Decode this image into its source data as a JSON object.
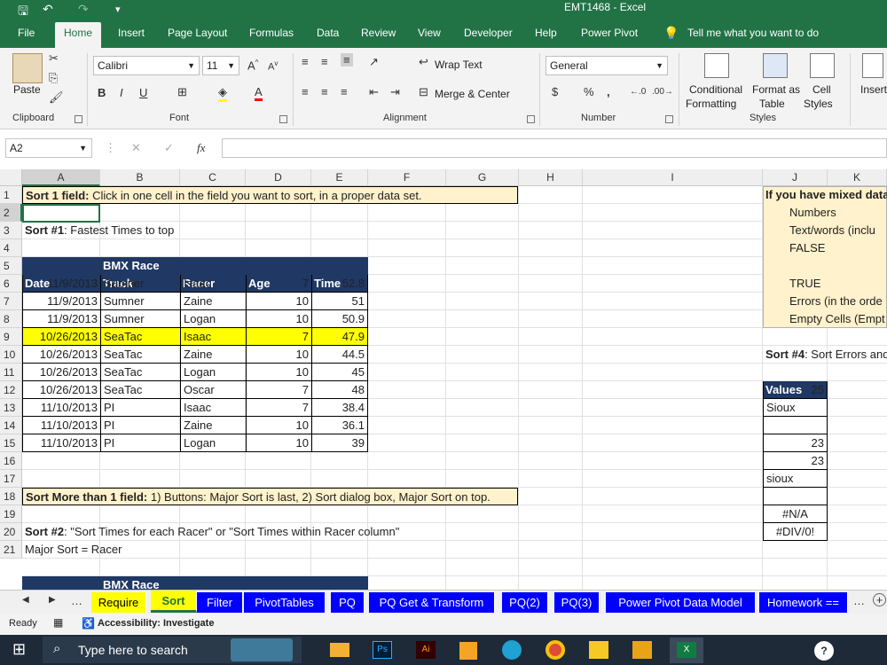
{
  "window": {
    "title": "EMT1468  -  Excel"
  },
  "menu": {
    "tabs": [
      "File",
      "Home",
      "Insert",
      "Page Layout",
      "Formulas",
      "Data",
      "Review",
      "View",
      "Developer",
      "Help",
      "Power Pivot"
    ],
    "tell_me": "Tell me what you want to do",
    "active": "Home"
  },
  "ribbon": {
    "paste": "Paste",
    "clipboard": "Clipboard",
    "font_name": "Calibri",
    "font_size": "11",
    "font": "Font",
    "wrap_text": "Wrap Text",
    "merge_center": "Merge & Center",
    "alignment": "Alignment",
    "number_format": "General",
    "number": "Number",
    "conditional_1": "Conditional",
    "conditional_2": "Formatting",
    "format_as_1": "Format as",
    "format_as_2": "Table",
    "cell_styles_1": "Cell",
    "cell_styles_2": "Styles",
    "styles": "Styles",
    "insert": "Insert",
    "bold": "B",
    "italic": "I",
    "underline": "U",
    "currency": "$",
    "percent": "%",
    "comma": ","
  },
  "formula_bar": {
    "name_box": "A2",
    "fx": "fx",
    "formula": ""
  },
  "columns": [
    "A",
    "B",
    "C",
    "D",
    "E",
    "F",
    "G",
    "H",
    "I",
    "J",
    "K"
  ],
  "rows": [
    "1",
    "2",
    "3",
    "4",
    "5",
    "6",
    "7",
    "8",
    "9",
    "10",
    "11",
    "12",
    "13",
    "14",
    "15",
    "16",
    "17",
    "18",
    "19",
    "20",
    "21"
  ],
  "cells": {
    "r1_bold": "Sort 1 field:",
    "r1_rest": " Click in one cell in the field you want to sort, in a proper data set.",
    "r3_bold": "Sort #1",
    "r3_rest": ": Fastest Times to top",
    "hdr_date": "Date",
    "hdr_track_1": "BMX Race",
    "hdr_track_2": "Track",
    "hdr_racer": "Racer",
    "hdr_age": "Age",
    "hdr_time": "Time",
    "table": [
      {
        "date": "11/9/2013",
        "track": "Sumner",
        "racer": "Isaac",
        "age": "7",
        "time": "52.8"
      },
      {
        "date": "11/9/2013",
        "track": "Sumner",
        "racer": "Zaine",
        "age": "10",
        "time": "51"
      },
      {
        "date": "11/9/2013",
        "track": "Sumner",
        "racer": "Logan",
        "age": "10",
        "time": "50.9"
      },
      {
        "date": "10/26/2013",
        "track": "SeaTac",
        "racer": "Isaac",
        "age": "7",
        "time": "47.9"
      },
      {
        "date": "10/26/2013",
        "track": "SeaTac",
        "racer": "Zaine",
        "age": "10",
        "time": "44.5"
      },
      {
        "date": "10/26/2013",
        "track": "SeaTac",
        "racer": "Logan",
        "age": "10",
        "time": "45"
      },
      {
        "date": "10/26/2013",
        "track": "SeaTac",
        "racer": "Oscar",
        "age": "7",
        "time": "48"
      },
      {
        "date": "11/10/2013",
        "track": "PI",
        "racer": "Isaac",
        "age": "7",
        "time": "38.4"
      },
      {
        "date": "11/10/2013",
        "track": "PI",
        "racer": "Zaine",
        "age": "10",
        "time": "36.1"
      },
      {
        "date": "11/10/2013",
        "track": "PI",
        "racer": "Logan",
        "age": "10",
        "time": "39"
      }
    ],
    "r17_bold": "Sort More than 1 field:",
    "r17_rest": " 1) Buttons: Major Sort is last, 2) Sort dialog box, Major Sort on top.",
    "r19_bold": "Sort #2",
    "r19_rest": ": \"Sort Times for each Racer\" or \"Sort Times within Racer column\"",
    "r20": "Major Sort = Racer",
    "r22_track": "BMX Race",
    "j1": "If you have mixed data",
    "j2": "Numbers",
    "j3": "Text/words (inclu",
    "j4": "FALSE",
    "j6": "TRUE",
    "j7": "Errors (in the orde",
    "j8": "Empty Cells (Empt",
    "j10_bold": "Sort #4",
    "j10_rest": ": Sort Errors and",
    "values_hdr": "Values",
    "values": [
      "25",
      "Sioux",
      "",
      "23",
      "23",
      "sioux",
      "",
      "#N/A",
      "#DIV/0!"
    ]
  },
  "sheet_tabs": [
    "Require",
    "Sort",
    "Filter",
    "PivotTables",
    "PQ",
    "PQ Get & Transform",
    "PQ(2)",
    "PQ(3)",
    "Power Pivot Data Model",
    "Homework =="
  ],
  "active_sheet": "Sort",
  "status": {
    "ready": "Ready",
    "accessibility": "Accessibility: Investigate"
  },
  "taskbar": {
    "search": "Type here to search"
  },
  "colors": {
    "excel_green": "#217346",
    "header_navy": "#1f3864",
    "note_yellow": "#fff2cc",
    "highlight_yellow": "#ffff00",
    "tab_blue": "#0000ff"
  }
}
